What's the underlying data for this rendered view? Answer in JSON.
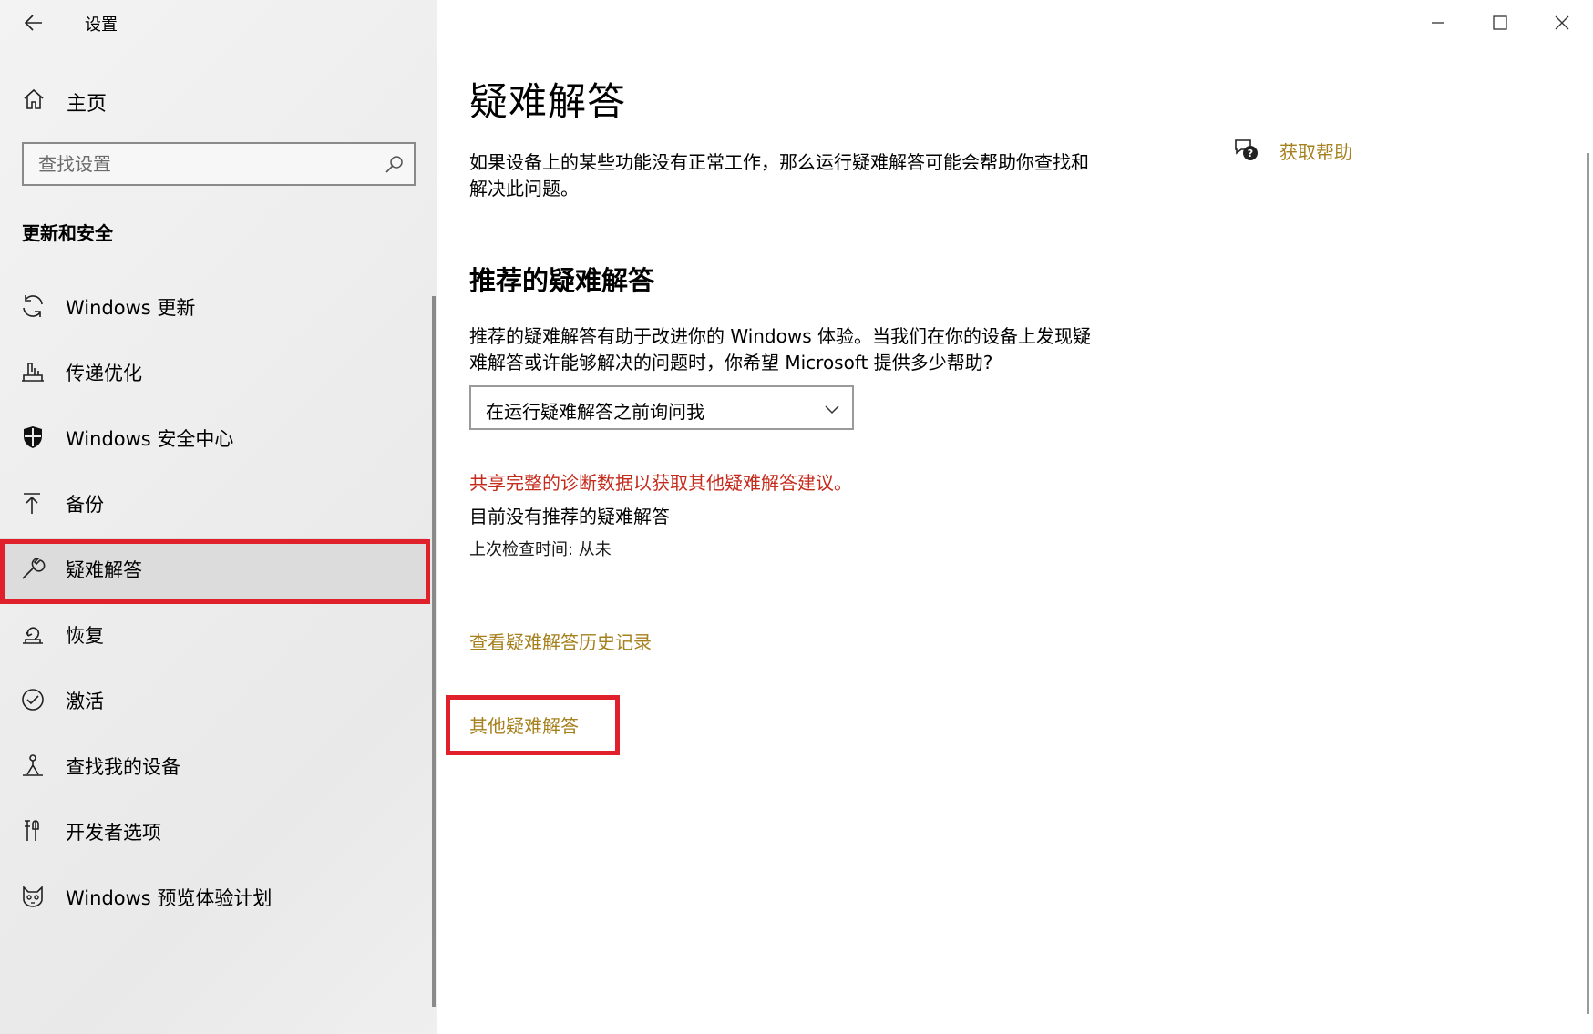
{
  "window": {
    "title": "设置",
    "controls": {
      "minimize": "minimize",
      "maximize": "maximize",
      "close": "close"
    }
  },
  "sidebar": {
    "home_label": "主页",
    "search_placeholder": "查找设置",
    "section_title": "更新和安全",
    "items": [
      {
        "label": "Windows 更新",
        "icon": "refresh-icon"
      },
      {
        "label": "传递优化",
        "icon": "delivery-optimization-icon"
      },
      {
        "label": "Windows 安全中心",
        "icon": "shield-icon"
      },
      {
        "label": "备份",
        "icon": "backup-arrow-icon"
      },
      {
        "label": "疑难解答",
        "icon": "wrench-icon",
        "selected": true
      },
      {
        "label": "恢复",
        "icon": "recovery-icon"
      },
      {
        "label": "激活",
        "icon": "check-circle-icon"
      },
      {
        "label": "查找我的设备",
        "icon": "find-device-icon"
      },
      {
        "label": "开发者选项",
        "icon": "developer-tools-icon"
      },
      {
        "label": "Windows 预览体验计划",
        "icon": "insider-cat-icon"
      }
    ]
  },
  "main": {
    "title": "疑难解答",
    "intro": "如果设备上的某些功能没有正常工作，那么运行疑难解答可能会帮助你查找和解决此问题。",
    "help_label": "获取帮助",
    "recommended_heading": "推荐的疑难解答",
    "recommended_desc": "推荐的疑难解答有助于改进你的 Windows 体验。当我们在你的设备上发现疑难解答或许能够解决的问题时，你希望 Microsoft 提供多少帮助?",
    "dropdown_value": "在运行疑难解答之前询问我",
    "warning_text": "共享完整的诊断数据以获取其他疑难解答建议。",
    "no_recommendations": "目前没有推荐的疑难解答",
    "last_check": "上次检查时间: 从未",
    "history_link": "查看疑难解答历史记录",
    "other_link": "其他疑难解答"
  },
  "colors": {
    "accent_link": "#a6801d",
    "warning": "#c42b1c",
    "highlight_box": "#e0202b"
  }
}
